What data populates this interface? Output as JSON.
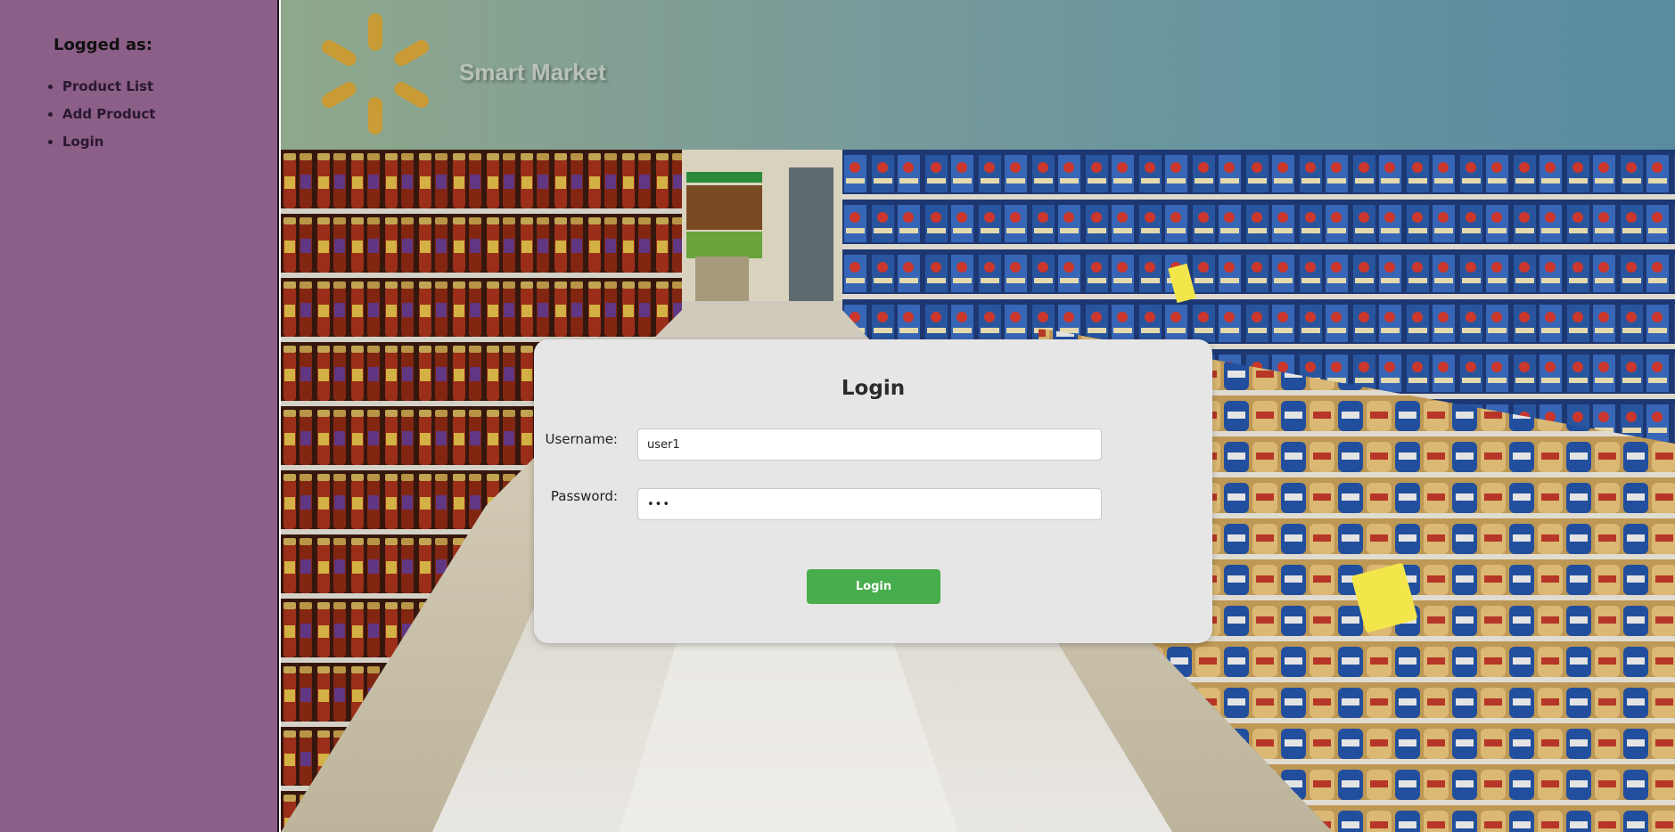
{
  "sidebar": {
    "title": "Logged as:",
    "items": [
      {
        "label": "Product List"
      },
      {
        "label": "Add Product"
      },
      {
        "label": "Login"
      }
    ]
  },
  "header": {
    "brand": "Smart Market",
    "logo_icon": "spark-logo-icon",
    "logo_color": "#d09a2c"
  },
  "login": {
    "title": "Login",
    "username_label": "Username:",
    "username_value": "user1",
    "password_label": "Password:",
    "password_value": "•••",
    "submit_label": "Login"
  },
  "colors": {
    "sidebar_bg": "#8b5f88",
    "button_bg": "#48ad4c",
    "card_bg": "#e6e6e6"
  }
}
